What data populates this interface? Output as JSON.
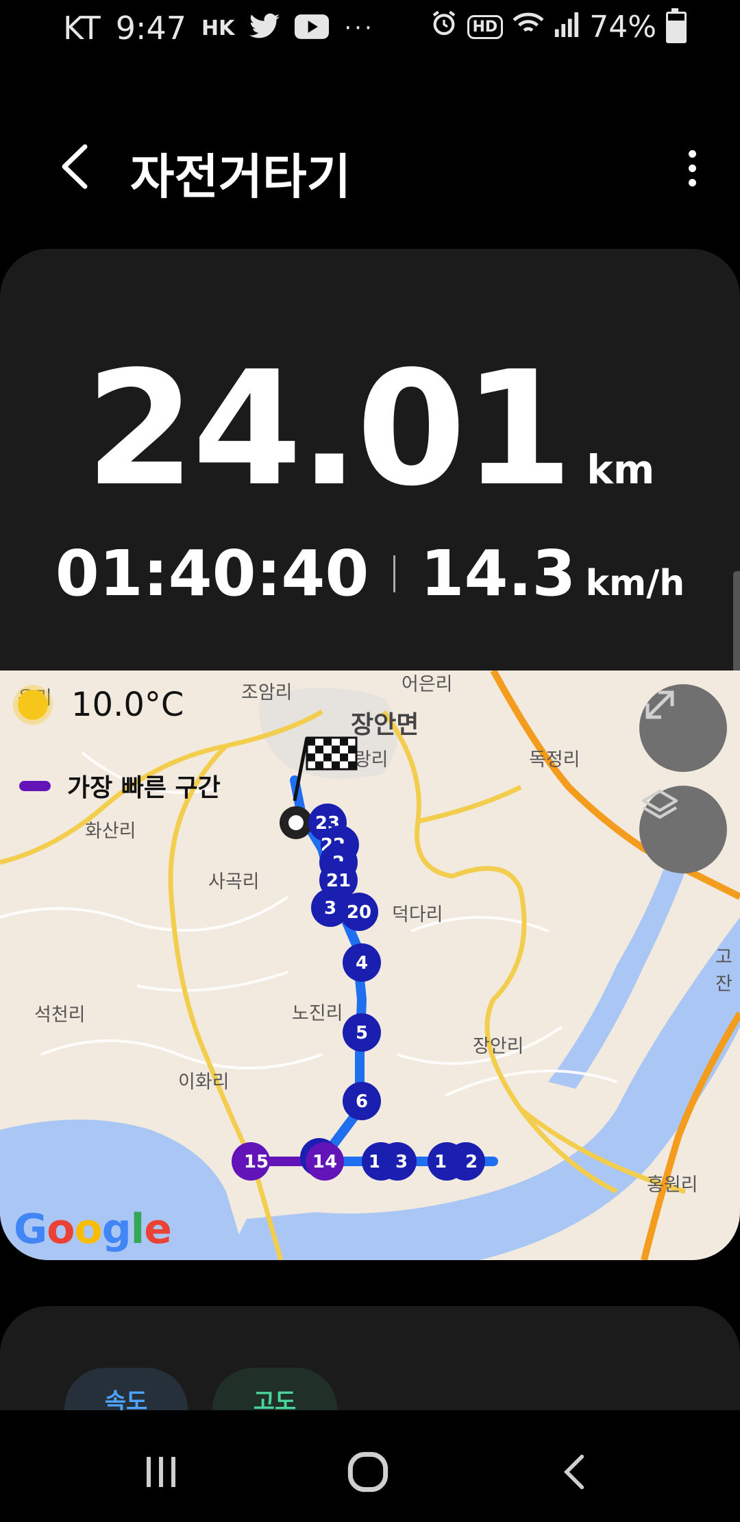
{
  "status_bar": {
    "carrier": "KT",
    "time": "9:47",
    "hk_label": "HK",
    "overflow": "···",
    "hd_label": "HD",
    "battery_percent": "74%",
    "battery_level": 0.74,
    "icons": [
      "twitter-icon",
      "youtube-icon",
      "alarm-icon",
      "hd-voice-icon",
      "wifi-icon",
      "signal-icon",
      "battery-icon"
    ]
  },
  "header": {
    "title": "자전거타기",
    "back_icon": "chevron-left-icon",
    "more_icon": "more-vertical-icon"
  },
  "summary": {
    "distance": "24.01",
    "distance_unit": "km",
    "duration": "01:40:40",
    "avg_speed": "14.3",
    "speed_unit": "km/h"
  },
  "map": {
    "temperature": "10.0°C",
    "weather_icon": "sun-icon",
    "legend_label": "가장 빠른 구간",
    "legend_color": "#6314b8",
    "route_color": "#1f6ff0",
    "marker_color": "#1a1fb0",
    "places": {
      "jangan_myeon": "장안면",
      "joam_ri": "조암리",
      "eoeun_ri": "어은리",
      "saryang_ri": "사랑리",
      "dokjeong_ri": "독정리",
      "hwasan_ri": "화산리",
      "sagok_ri": "사곡리",
      "deokdari": "덕다리",
      "seokcheon_ri": "석천리",
      "nojin_ri": "노진리",
      "jangan_ri": "장안리",
      "ihwa_ri": "이화리",
      "hongwon_ri": "홍원리",
      "go_partial": "고잔",
      "un_partial": "운리"
    },
    "markers": {
      "m23": "23",
      "m22": "22",
      "m2": "2",
      "m21": "21",
      "m3": "3",
      "m20": "20",
      "m4": "4",
      "m5": "5",
      "m6": "6",
      "m15": "15",
      "m14": "14",
      "m10": "10",
      "m3b": "3",
      "m11": "11",
      "m2b": "2"
    },
    "google_logo": [
      "G",
      "o",
      "o",
      "g",
      "l",
      "e"
    ],
    "buttons": [
      "expand-icon",
      "layers-icon"
    ]
  },
  "tabs": {
    "speed_label": "속도",
    "altitude_label": "고도"
  },
  "navbar": {
    "icons": [
      "recent-apps-icon",
      "home-icon",
      "back-icon"
    ]
  }
}
